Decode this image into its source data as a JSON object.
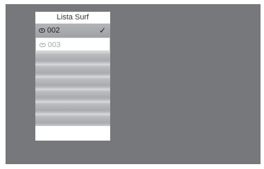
{
  "panel": {
    "title": "Lista Surf"
  },
  "channels": [
    {
      "number": "002",
      "selected": true,
      "check": "✓"
    },
    {
      "number": "003",
      "selected": false,
      "check": ""
    }
  ],
  "empty_rows": 6,
  "colors": {
    "background": "#76787b",
    "panel": "#ffffff",
    "selected_row": "#a9abae",
    "dimmed_text": "#a6a6a6"
  }
}
